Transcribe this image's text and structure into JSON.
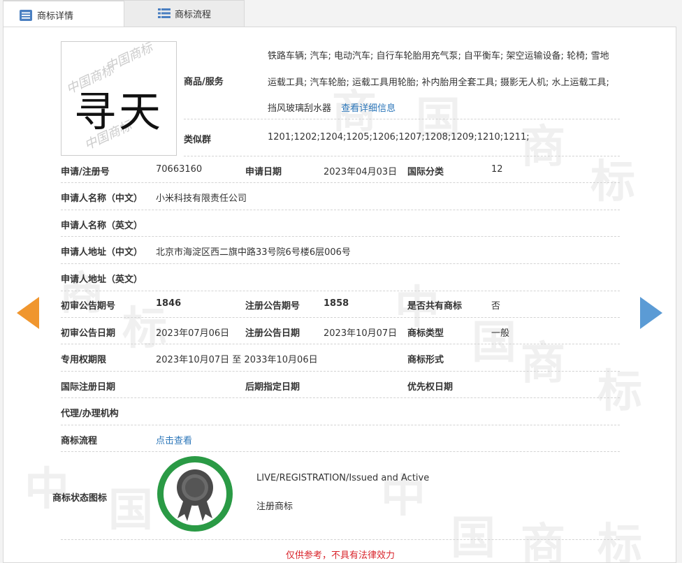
{
  "tabs": {
    "detail": "商标详情",
    "flow": "商标流程"
  },
  "logo": {
    "text": "寻天",
    "watermark": "中国商标"
  },
  "goods": {
    "label": "商品/服务",
    "line1": "铁路车辆; 汽车; 电动汽车; 自行车轮胎用充气泵; 自平衡车; 架空运输设备; 轮椅; 雪地",
    "line2": "运载工具; 汽车轮胎; 运载工具用轮胎; 补内胎用全套工具; 摄影无人机; 水上运载工具;",
    "line3": "挡风玻璃刮水器",
    "more_link": "查看详细信息"
  },
  "similar_group": {
    "label": "类似群",
    "value": "1201;1202;1204;1205;1206;1207;1208;1209;1210;1211;"
  },
  "fields": {
    "reg_no_label": "申请/注册号",
    "reg_no": "70663160",
    "apply_date_label": "申请日期",
    "apply_date": "2023年04月03日",
    "intl_class_label": "国际分类",
    "intl_class": "12",
    "applicant_cn_label": "申请人名称（中文）",
    "applicant_cn": "小米科技有限责任公司",
    "applicant_en_label": "申请人名称（英文）",
    "applicant_en": "",
    "address_cn_label": "申请人地址（中文）",
    "address_cn": "北京市海淀区西二旗中路33号院6号楼6层006号",
    "address_en_label": "申请人地址（英文）",
    "address_en": "",
    "prelim_no_label": "初审公告期号",
    "prelim_no": "1846",
    "reg_pub_no_label": "注册公告期号",
    "reg_pub_no": "1858",
    "shared_label": "是否共有商标",
    "shared": "否",
    "prelim_date_label": "初审公告日期",
    "prelim_date": "2023年07月06日",
    "reg_pub_date_label": "注册公告日期",
    "reg_pub_date": "2023年10月07日",
    "tm_type_label": "商标类型",
    "tm_type": "一般",
    "exclusive_label": "专用权期限",
    "exclusive": "2023年10月07日 至 2033年10月06日",
    "tm_form_label": "商标形式",
    "tm_form": "",
    "intl_reg_date_label": "国际注册日期",
    "later_date_label": "后期指定日期",
    "priority_date_label": "优先权日期",
    "agent_label": "代理/办理机构",
    "agent": "",
    "flow_label": "商标流程",
    "flow_link": "点击查看",
    "status_icon_label": "商标状态图标"
  },
  "status": {
    "line1": "LIVE/REGISTRATION/Issued and Active",
    "line2": "注册商标"
  },
  "footer": {
    "notice": "仅供参考，不具有法律效力"
  },
  "watermark": {
    "zh": "中",
    "guo": "国",
    "shang": "商",
    "biao": "标"
  },
  "colors": {
    "link": "#2b76b9",
    "badge_ring": "#2a9a45",
    "notice": "#d9242b",
    "prev_arrow": "#f0962e",
    "next_arrow": "#5b9bd5"
  },
  "icons": {
    "detail_tab": "document-list-icon",
    "flow_tab": "list-icon",
    "prev": "chevron-left-icon",
    "next": "chevron-right-icon",
    "status": "award-ribbon-icon"
  }
}
